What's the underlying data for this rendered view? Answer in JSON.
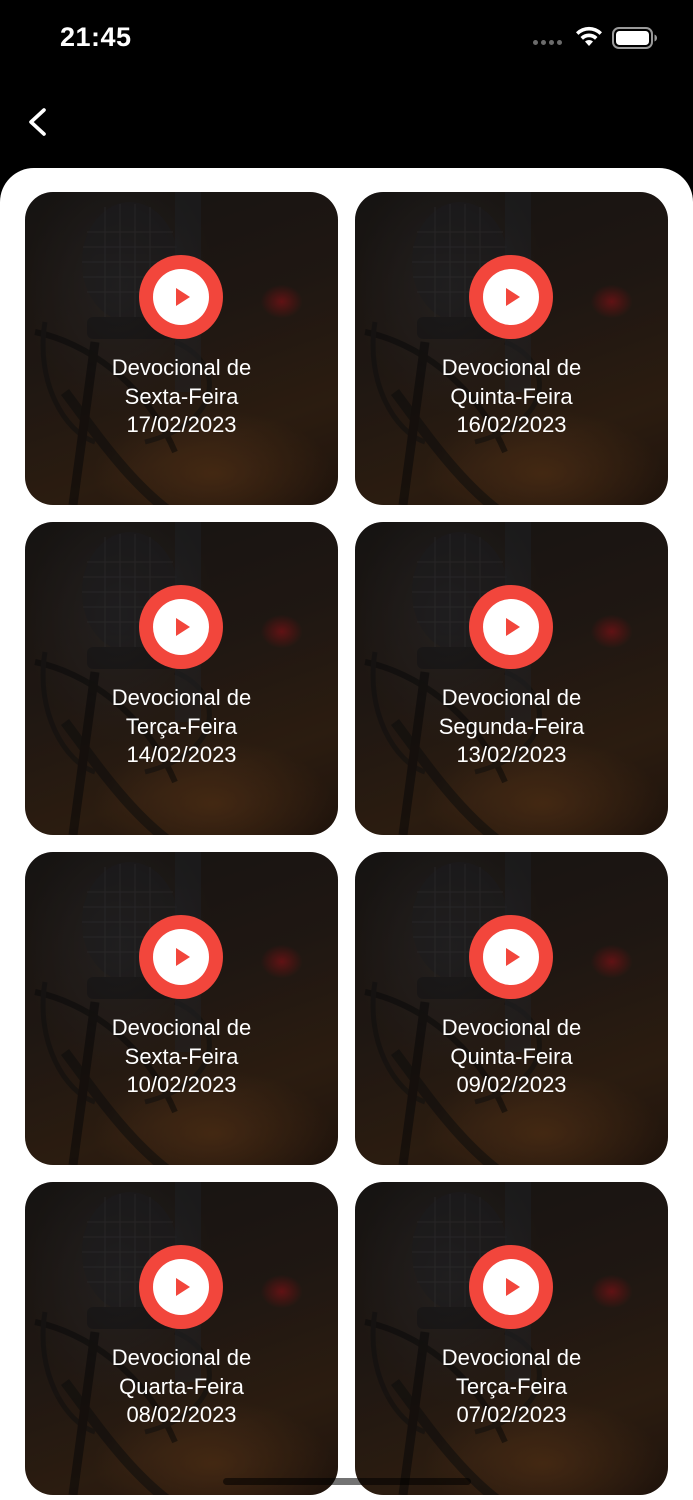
{
  "status_bar": {
    "time": "21:45"
  },
  "nav": {
    "back_icon": "chevron-left-icon"
  },
  "colors": {
    "accent": "#f2463c",
    "background": "#000000",
    "sheet": "#ffffff"
  },
  "episodes": [
    {
      "line1": "Devocional de",
      "line2": "Sexta-Feira",
      "date": "17/02/2023"
    },
    {
      "line1": "Devocional de",
      "line2": "Quinta-Feira",
      "date": "16/02/2023"
    },
    {
      "line1": "Devocional de",
      "line2": "Terça-Feira",
      "date": "14/02/2023"
    },
    {
      "line1": "Devocional de",
      "line2": "Segunda-Feira",
      "date": "13/02/2023"
    },
    {
      "line1": "Devocional de",
      "line2": "Sexta-Feira",
      "date": "10/02/2023"
    },
    {
      "line1": "Devocional de",
      "line2": "Quinta-Feira",
      "date": "09/02/2023"
    },
    {
      "line1": "Devocional de",
      "line2": "Quarta-Feira",
      "date": "08/02/2023"
    },
    {
      "line1": "Devocional de",
      "line2": "Terça-Feira",
      "date": "07/02/2023"
    }
  ]
}
